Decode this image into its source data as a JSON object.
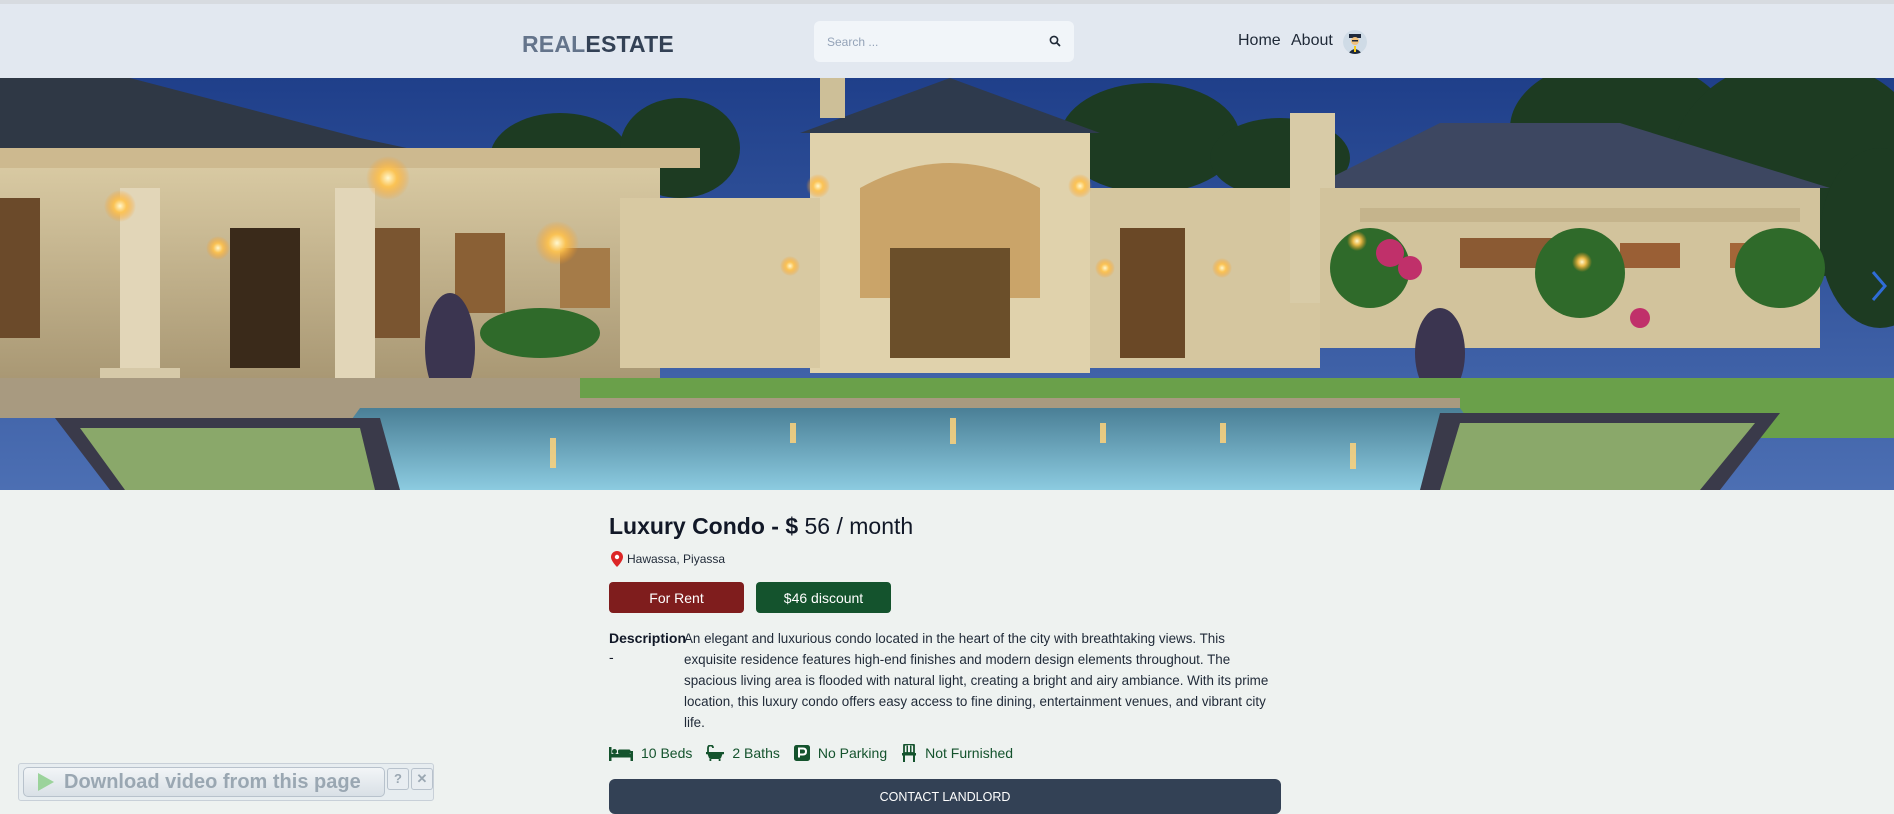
{
  "header": {
    "logo_part1": "REAL",
    "logo_part2": "ESTATE",
    "search_placeholder": "Search ...",
    "nav": {
      "home": "Home",
      "about": "About"
    }
  },
  "listing": {
    "name": "Luxury Condo",
    "price_prefix": " - $ ",
    "price": "56 / month",
    "location": "Hawassa, Piyassa",
    "type_badge": "For Rent",
    "discount_badge": "$46 discount",
    "description_label": "Description",
    "description_dash": "-",
    "description": "An elegant and luxurious condo located in the heart of the city with breathtaking views. This exquisite residence features high-end finishes and modern design elements throughout. The spacious living area is flooded with natural light, creating a bright and airy ambiance. With its prime location, this luxury condo offers easy access to fine dining, entertainment venues, and vibrant city life.",
    "features": {
      "beds": "10 Beds",
      "baths": "2 Baths",
      "parking": "No Parking",
      "furnished": "Not Furnished"
    },
    "contact_button": "CONTACT LANDLORD"
  },
  "download_overlay": {
    "label": "Download video from this page",
    "help": "?",
    "close": "✕"
  },
  "colors": {
    "header_bg": "#e2e8f0",
    "rent_badge": "#7f1d1d",
    "discount_badge": "#14532d",
    "contact_button": "#334155",
    "feature_text": "#14532d"
  },
  "icons": [
    "search-icon",
    "user-avatar",
    "map-pin-icon",
    "bed-icon",
    "bath-icon",
    "parking-icon",
    "chair-icon",
    "chevron-right-icon",
    "play-icon"
  ]
}
